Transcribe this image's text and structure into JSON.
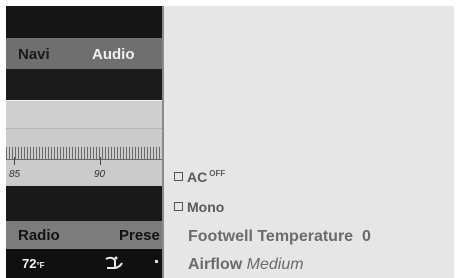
{
  "nav": {
    "tabs": [
      {
        "label": "Navi",
        "selected": false
      },
      {
        "label": "Audio",
        "selected": true
      }
    ]
  },
  "tuner": {
    "freq_labels": [
      "85",
      "90"
    ]
  },
  "menu": {
    "items": [
      "Radio",
      "Prese"
    ]
  },
  "climate": {
    "temp_value": "72",
    "temp_unit": "°F",
    "fan_icon": "air-distribution-icon"
  },
  "options": {
    "ac": {
      "label": "AC",
      "state": "OFF"
    },
    "mono": {
      "label": "Mono"
    },
    "footwell": {
      "label": "Footwell Temperature",
      "value": "0"
    },
    "airflow": {
      "label": "Airflow",
      "value": "Medium"
    }
  },
  "colors": {
    "selected_text": "#f0f0f0",
    "option_text": "#5a5a5a",
    "dark_band": "#161616"
  }
}
